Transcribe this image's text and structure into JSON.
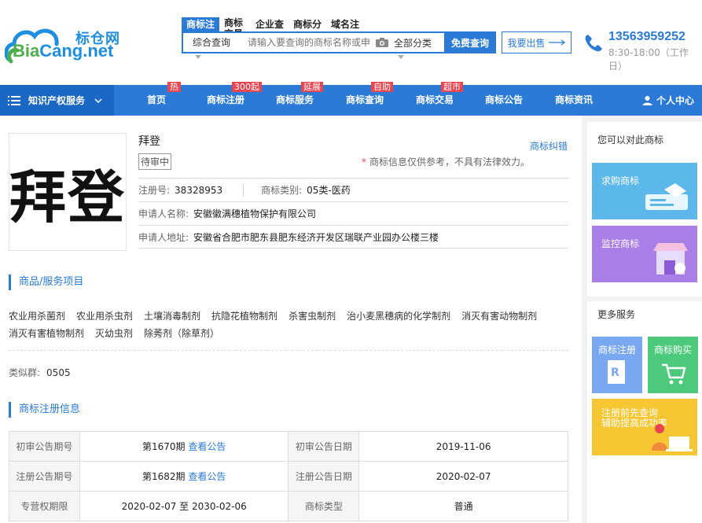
{
  "header": {
    "logo_cn": "标仓网",
    "logo_en_a": "Bia",
    "logo_en_b": "Cang.net",
    "search_tabs": [
      "商标注",
      "商标交易",
      "企业查",
      "商标分",
      "域名注"
    ],
    "search_scope": "综合查询",
    "search_placeholder": "请输入要查询的商标名称或申",
    "search_category": "全部分类",
    "search_button": "免费查询",
    "sell_button": "我要出售",
    "phone": "13563959252",
    "hours": "8:30-18:00（工作日）"
  },
  "nav": {
    "category_label": "知识产权服务",
    "items": [
      {
        "label": "首页",
        "badge": "热"
      },
      {
        "label": "商标注册",
        "badge": "300起"
      },
      {
        "label": "商标服务",
        "badge": "延展"
      },
      {
        "label": "商标查询",
        "badge": "自助"
      },
      {
        "label": "商标交易",
        "badge": "超市"
      },
      {
        "label": "商标公告",
        "badge": ""
      },
      {
        "label": "商标资讯",
        "badge": ""
      }
    ],
    "user_label": "个人中心"
  },
  "brand": {
    "image_text": "拜登",
    "title": "拜登",
    "status": "待审中",
    "report_link": "商标纠错",
    "disclaimer": "商标信息仅供参考，不具有法律效力。",
    "reg_no_label": "注册号:",
    "reg_no": "38328953",
    "class_label": "商标类别:",
    "class_value": "05类-医药",
    "applicant_label": "申请人名称:",
    "applicant": "安徽徽满穗植物保护有限公司",
    "address_label": "申请人地址:",
    "address": "安徽省合肥市肥东县肥东经济开发区瑞联产业园办公楼三楼"
  },
  "goods": {
    "section_title": "商品/服务项目",
    "items": [
      "农业用杀菌剂",
      "农业用杀虫剂",
      "土壤消毒制剂",
      "抗隐花植物制剂",
      "杀害虫制剂",
      "治小麦黑穗病的化学制剂",
      "消灭有害动物制剂",
      "消灭有害植物制剂",
      "灭幼虫剂",
      "除莠剂（除草剂）"
    ],
    "similar_label": "类似群:",
    "similar_value": "0505"
  },
  "registration": {
    "section_title": "商标注册信息",
    "rows": [
      {
        "k1": "初审公告期号",
        "v1": "第1670期",
        "link1": "查看公告",
        "k2": "初审公告日期",
        "v2": "2019-11-06"
      },
      {
        "k1": "注册公告期号",
        "v1": "第1682期",
        "link1": "查看公告",
        "k2": "注册公告日期",
        "v2": "2020-02-07"
      },
      {
        "k1": "专营权期限",
        "v1": "2020-02-07 至 2030-02-06",
        "link1": "",
        "k2": "商标类型",
        "v2": "普通"
      }
    ]
  },
  "sidebar": {
    "head1": "您可以对此商标",
    "card_buy": "求购商标",
    "card_monitor": "监控商标",
    "head2": "更多服务",
    "small_reg": "商标注册",
    "small_buy": "商标购买",
    "card_query_1": "注册前先查询",
    "card_query_2": "辅助提高成功率"
  }
}
